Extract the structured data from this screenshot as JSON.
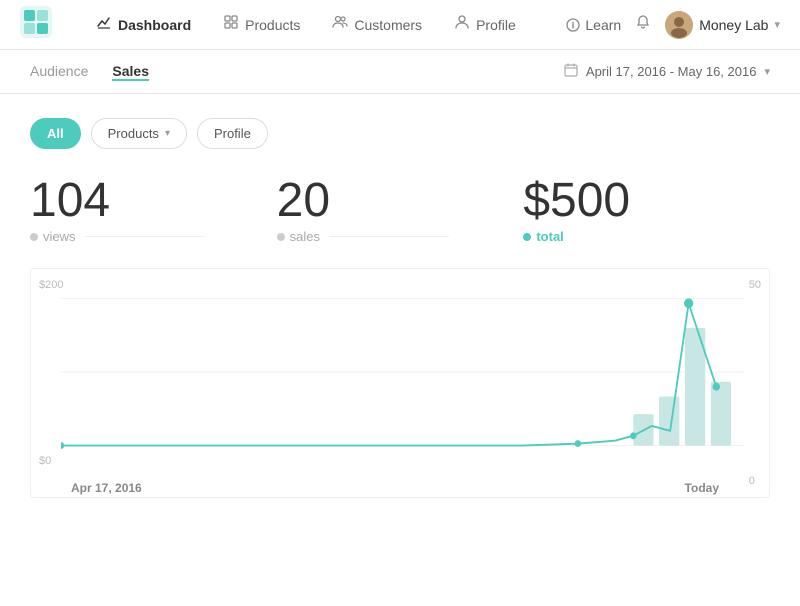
{
  "nav": {
    "logo_label": "G",
    "items": [
      {
        "label": "Dashboard",
        "active": true,
        "icon": "chart-icon"
      },
      {
        "label": "Products",
        "active": false,
        "icon": "products-icon"
      },
      {
        "label": "Customers",
        "active": false,
        "icon": "customers-icon"
      },
      {
        "label": "Profile",
        "active": false,
        "icon": "profile-icon"
      }
    ],
    "learn_label": "Learn",
    "user_label": "Money Lab",
    "chevron": "▾"
  },
  "subnav": {
    "items": [
      {
        "label": "Audience",
        "active": false
      },
      {
        "label": "Sales",
        "active": true
      }
    ],
    "date_range": "April 17, 2016 - May 16, 2016",
    "chevron": "▾"
  },
  "filters": {
    "all_label": "All",
    "products_label": "Products",
    "profile_label": "Profile"
  },
  "stats": {
    "views_value": "104",
    "views_label": "views",
    "sales_value": "20",
    "sales_label": "sales",
    "total_value": "$500",
    "total_label": "total"
  },
  "chart": {
    "y_labels": [
      "50",
      "0"
    ],
    "x_labels": [
      "Apr 17, 2016",
      "Today"
    ],
    "dollar_labels": [
      "$200",
      "$0"
    ],
    "accent_color": "#4DCCBD",
    "bar_color": "#c8e8e4"
  }
}
